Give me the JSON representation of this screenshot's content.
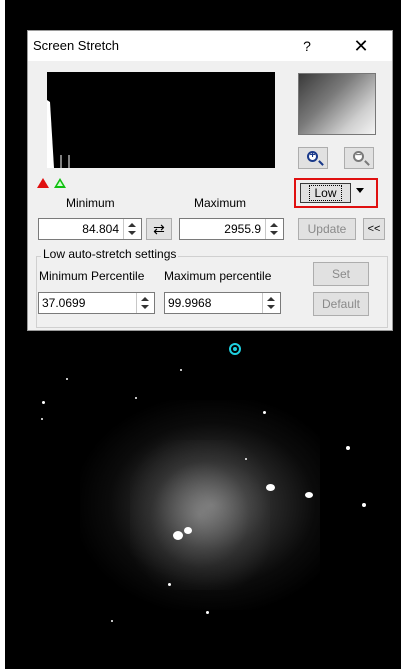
{
  "dialog": {
    "title": "Screen Stretch",
    "help_label": "?",
    "close_label": "✕"
  },
  "preset": {
    "selected": "Low"
  },
  "range": {
    "minimum_label": "Minimum",
    "maximum_label": "Maximum",
    "minimum_value": "84.804",
    "maximum_value": "2955.9",
    "swap_label": "⇄",
    "update_label": "Update",
    "collapse_label": "<<"
  },
  "auto_stretch": {
    "group_title": "Low auto-stretch settings",
    "min_percentile_label": "Minimum Percentile",
    "max_percentile_label": "Maximum percentile",
    "min_percentile_value": "37.0699",
    "max_percentile_value": "99.9968",
    "set_label": "Set",
    "default_label": "Default"
  },
  "icons": {
    "zoom_in": "zoom-in-icon",
    "zoom_out": "zoom-out-icon",
    "dropdown": "chevron-down-icon",
    "swap": "swap-icon",
    "target": "target-marker-icon"
  },
  "colors": {
    "highlight_border": "#e01010",
    "min_marker": "#e01010",
    "max_marker": "#10c010",
    "target_marker": "#1fd0e0"
  }
}
